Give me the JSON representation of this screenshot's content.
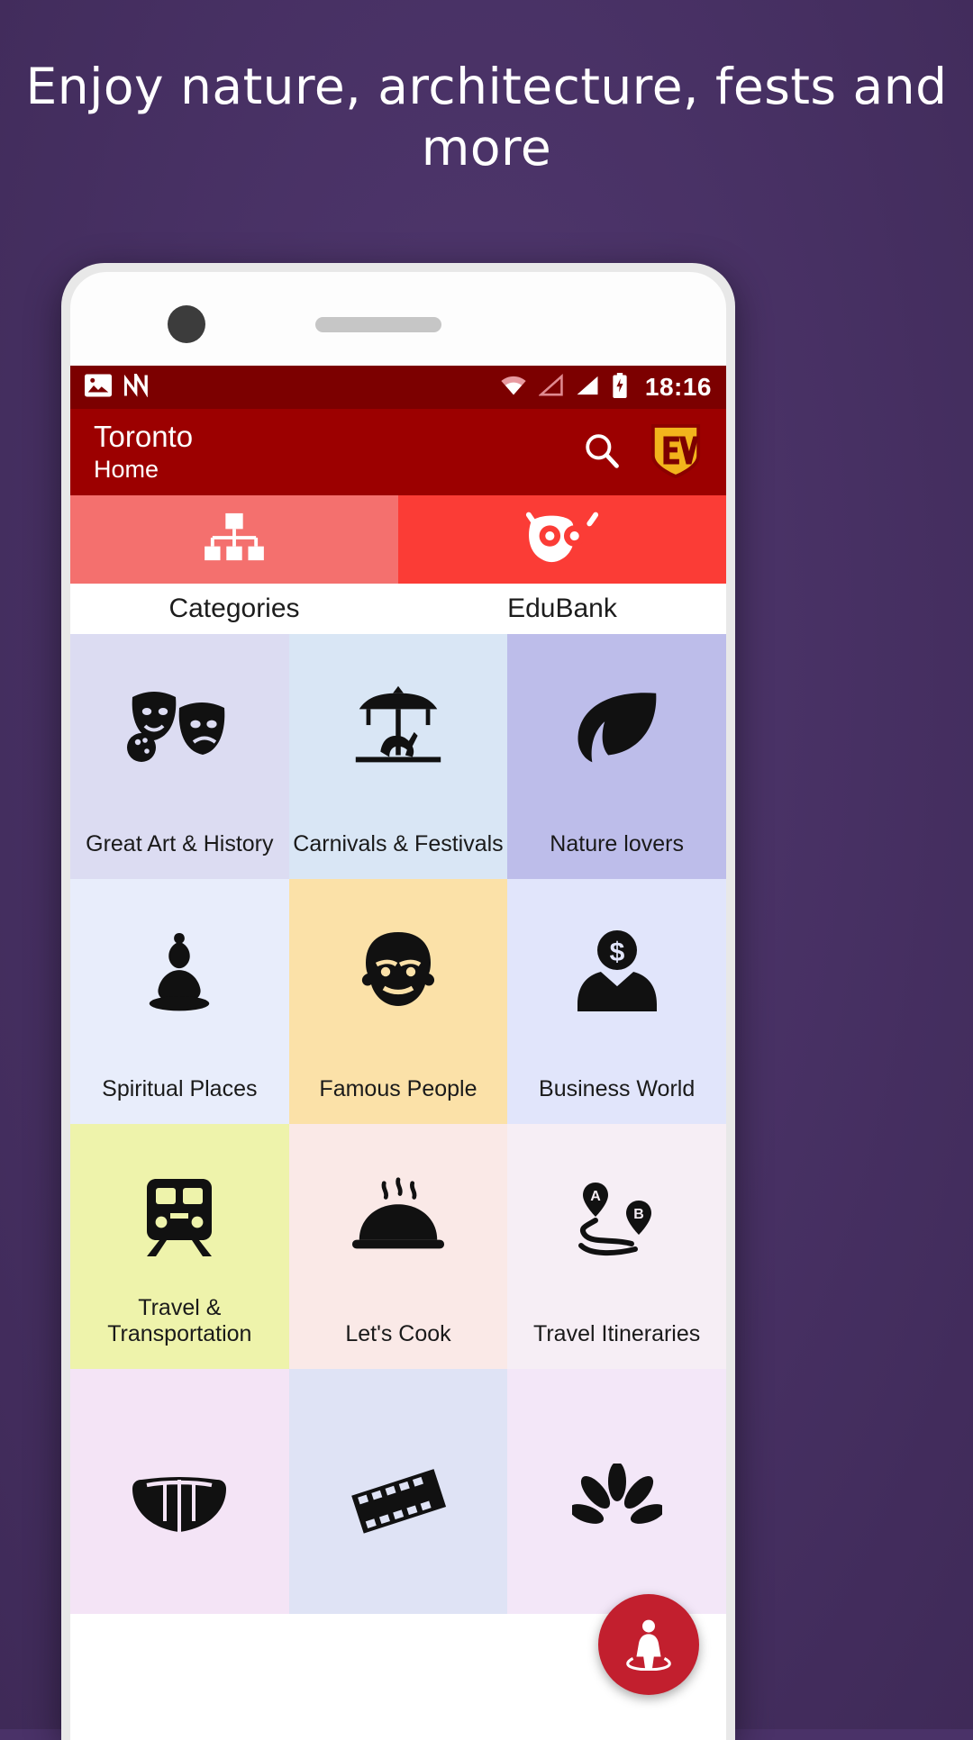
{
  "headline": "Enjoy nature, architecture, fests and more",
  "status_bar": {
    "time": "18:16",
    "icons": [
      "image-icon",
      "nfc-icon",
      "wifi-icon",
      "signal-empty-icon",
      "signal-full-icon",
      "battery-icon"
    ]
  },
  "app_bar": {
    "title": "Toronto",
    "subtitle": "Home",
    "search_icon": "search-icon",
    "logo_label": "EV"
  },
  "tabs": [
    {
      "label": "Categories",
      "icon": "sitemap-icon",
      "selected": false
    },
    {
      "label": "EduBank",
      "icon": "owl-icon",
      "selected": true
    }
  ],
  "categories": [
    {
      "label": "Great Art & History",
      "icon": "theater-masks-icon",
      "bg": "#dcdcf2"
    },
    {
      "label": "Carnivals & Festivals",
      "icon": "carousel-icon",
      "bg": "#d9e6f5"
    },
    {
      "label": "Nature lovers",
      "icon": "leaf-icon",
      "bg": "#bdbdea"
    },
    {
      "label": "Spiritual Places",
      "icon": "buddha-icon",
      "bg": "#e8edfb"
    },
    {
      "label": "Famous People",
      "icon": "person-face-icon",
      "bg": "#fbe1a8"
    },
    {
      "label": "Business World",
      "icon": "businessman-icon",
      "bg": "#e1e5fb"
    },
    {
      "label": "Travel & Transportation",
      "icon": "train-icon",
      "bg": "#eef3ab"
    },
    {
      "label": "Let's Cook",
      "icon": "food-dome-icon",
      "bg": "#fae9e7"
    },
    {
      "label": "Travel Itineraries",
      "icon": "route-a-b-icon",
      "bg": "#f6eef5"
    },
    {
      "label": "",
      "icon": "hand-fan-icon",
      "bg": "#f4e4f6"
    },
    {
      "label": "",
      "icon": "film-strip-icon",
      "bg": "#dfe3f5"
    },
    {
      "label": "",
      "icon": "flower-icon",
      "bg": "#f3e7f8"
    }
  ],
  "fab": {
    "icon": "person-pin-icon",
    "color": "#c21f2e"
  },
  "colors": {
    "backdrop": "#4a3268",
    "status_bar": "#7c0000",
    "app_bar": "#9c0000",
    "tab_inactive": "#f4706e",
    "tab_active": "#fb3c36"
  }
}
